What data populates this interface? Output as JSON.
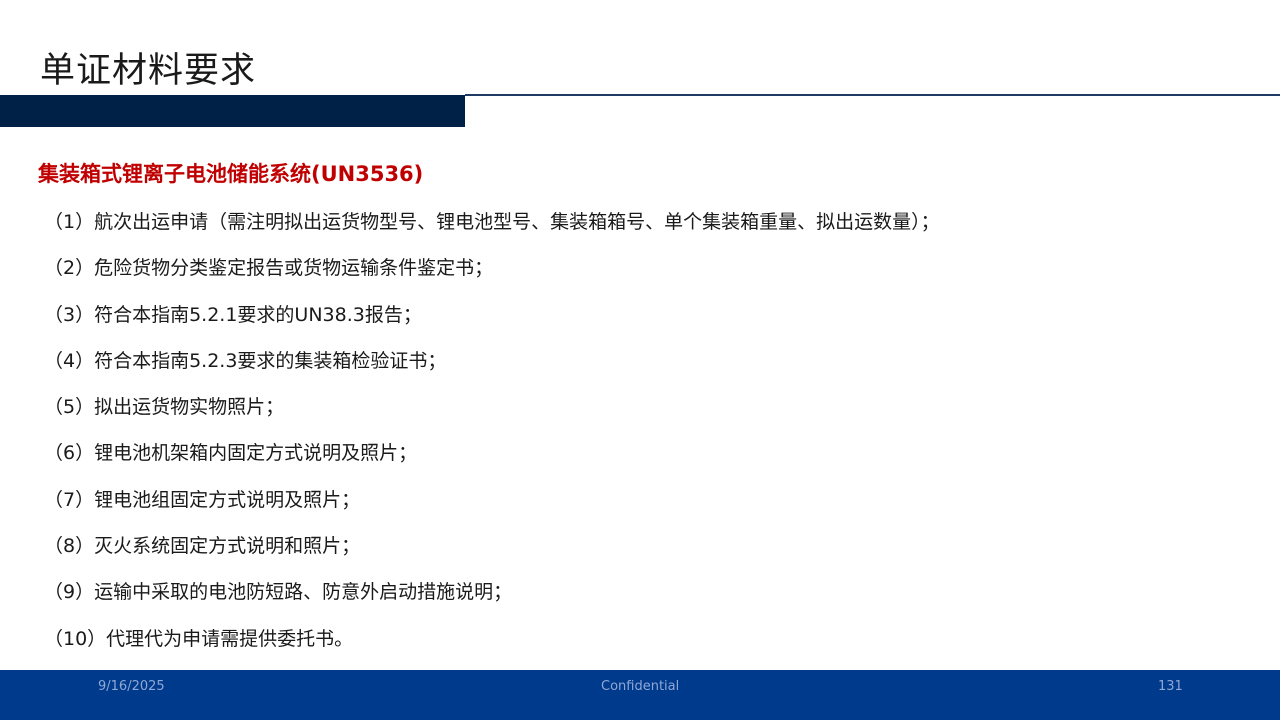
{
  "slide": {
    "title": "单证材料要求",
    "subtitle": "集装箱式锂离子电池储能系统(UN3536)",
    "items": [
      "（1）航次出运申请（需注明拟出运货物型号、锂电池型号、集装箱箱号、单个集装箱重量、拟出运数量）；",
      "（2）危险货物分类鉴定报告或货物运输条件鉴定书；",
      "（3）符合本指南5.2.1要求的UN38.3报告；",
      "（4）符合本指南5.2.3要求的集装箱检验证书；",
      "（5）拟出运货物实物照片；",
      "（6）锂电池机架箱内固定方式说明及照片；",
      "（7）锂电池组固定方式说明及照片；",
      "（8）灭火系统固定方式说明和照片；",
      "（9）运输中采取的电池防短路、防意外启动措施说明；",
      "（10）代理代为申请需提供委托书。"
    ]
  },
  "footer": {
    "date": "9/16/2025",
    "confidential": "Confidential",
    "page_number": "131"
  },
  "colors": {
    "header_bar": "#002147",
    "subtitle": "#c00000",
    "footer": "#003a8c"
  }
}
